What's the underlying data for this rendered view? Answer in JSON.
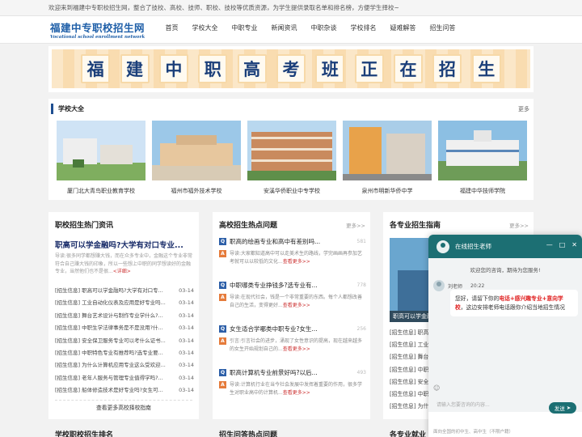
{
  "topbar": {
    "text": "欢迎来到福建中专职校招生网，整合了技校、高校、技师、职校、技校等优质资源，为学生提供录取名单和排名榜，方便学生择校~"
  },
  "logo": {
    "cn": "福建中专职校招生网",
    "en": "Vocational school enrollment network"
  },
  "nav": [
    "首页",
    "学校大全",
    "中职专业",
    "新闻资讯",
    "中职杂谈",
    "学校排名",
    "疑难解答",
    "招生问答"
  ],
  "banner": {
    "chars": [
      "福",
      "建",
      "中",
      "职",
      "高",
      "考",
      "班",
      "正",
      "在",
      "招",
      "生"
    ]
  },
  "schools": {
    "title": "学校大全",
    "more": "更多",
    "items": [
      {
        "name": "厦门北大青鸟职业教育学校"
      },
      {
        "name": "福州市福外技术学校"
      },
      {
        "name": "安溪华侨职业中专学校"
      },
      {
        "name": "泉州市明新华侨中学"
      },
      {
        "name": "福建中华技师学院"
      }
    ]
  },
  "col1": {
    "title": "职校招生热门资讯",
    "headline": "职高可以学金融吗?大学有对口专业...",
    "desc": "导读:很多同学都想赚大钱，而在众多专业中，金融这个专业非常符合自己赚大钱的印象，所以一些想上中职的同学想读好的金融专业，当然他们也不是很...",
    "desc_link": "<详细>",
    "news": [
      {
        "t": "[招生信息]  职高可以学金融吗?大学有对口专...",
        "d": "03-14"
      },
      {
        "t": "[招生信息]  工业自动化仪表及应用是好专业吗...",
        "d": "03-14"
      },
      {
        "t": "[招生信息]  舞台艺术设计与制作专业学什么?...",
        "d": "03-14"
      },
      {
        "t": "[招生信息]  中职生学法律事务是不是没用?什...",
        "d": "03-14"
      },
      {
        "t": "[招生信息]  安全保卫服务专业可以考什么证书...",
        "d": "03-14"
      },
      {
        "t": "[招生信息]  中职特色专业有推荐吗?选专业要...",
        "d": "03-14"
      },
      {
        "t": "[招生信息]  为什么计算机应用专业这么受欢迎...",
        "d": "03-14"
      },
      {
        "t": "[招生信息]  老年人服务与管理专业值得学吗?...",
        "d": "03-14"
      },
      {
        "t": "[招生信息]  船体修造技术是好专业吗?女生可...",
        "d": "03-14"
      }
    ],
    "footer": "查看更多高校择校指南"
  },
  "col2": {
    "title": "高校招生热点问题",
    "more": "更多>>",
    "qa": [
      {
        "q": "职高的绘画专业和高中有差别吗...",
        "views": "581",
        "a": "导读:大家都知道高中可以走美术生的路线，学完画画再参加艺考就可以以较低的文化...",
        "link": "查看更多>>"
      },
      {
        "q": "中职哪类专业挣钱多?选专业有...",
        "views": "778",
        "a": "导读:在现代社会，钱是一个非常重要的东西。每个人都想改善自己的生活，变得更好...",
        "link": "查看更多>>"
      },
      {
        "q": "女生适合学哪类中职专业?女生...",
        "views": "256",
        "a": "引言:引言社会的进步，涌现了女性意识的提高，现在越来越多的女生开始规划自己的...",
        "link": "查看更多>>"
      },
      {
        "q": "职高计算机专业前景好吗?以后...",
        "views": "493",
        "a": "导读:计算机行业在当今社会发展中发挥着重要的作用，很多学生对职业高中的计算机...",
        "link": "查看更多>>"
      }
    ]
  },
  "col3": {
    "title": "各专业招生指南",
    "more": "更多>>",
    "caption": "职高可以学金融吗?大学有对口专业...",
    "list": [
      "[招生信息]  职高可以学金融...",
      "[招生信息]  工业自动化仪表...",
      "[招生信息]  舞台艺术设计与...",
      "[招生信息]  中职生学法律事...",
      "[招生信息]  安全保卫服务专...",
      "[招生信息]  中职特色专业有...",
      "[招生信息]  为什么计算机应..."
    ]
  },
  "bottom": {
    "left": "学校职校招生排名",
    "mid": "招生问答热点问题",
    "right": "各专业就业"
  },
  "chat": {
    "title": "在线招生老师",
    "welcome": "欢迎您的咨询，期待为您服务!",
    "agent": "刘老师",
    "time": "20:22",
    "msg_pre": "您好，请留下你的",
    "msg_red": "电话+感兴趣专业+意向学校",
    "msg_post": "，这边安排老师电话跟你介绍当地招生情况",
    "input_placeholder": "请输入您要咨询的内容...",
    "send": "发送",
    "footer": "面向全国的初中生、高中生（不限户籍）"
  }
}
